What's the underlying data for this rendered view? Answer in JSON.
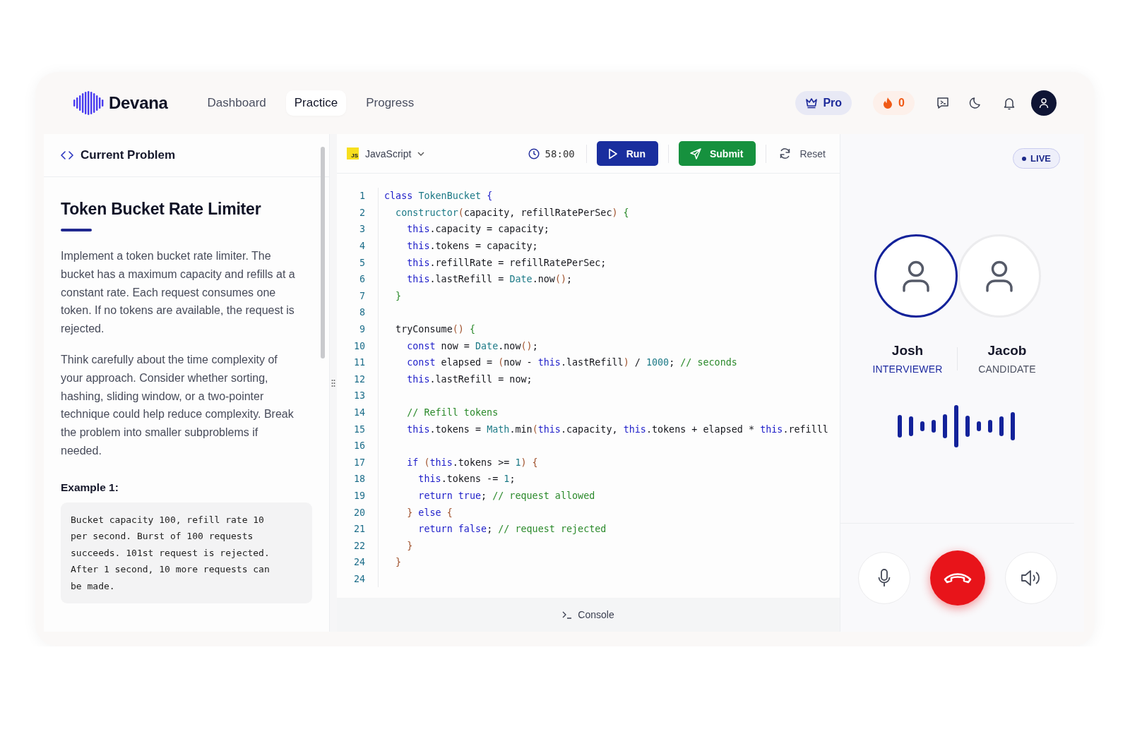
{
  "header": {
    "logo": "Devana",
    "tabs": [
      {
        "label": "Dashboard",
        "selected": false
      },
      {
        "label": "Practice",
        "selected": true
      },
      {
        "label": "Progress",
        "selected": false
      }
    ],
    "plan": "Pro",
    "streak": "0"
  },
  "problem_panel": {
    "heading": "Current Problem",
    "title": "Token Bucket Rate Limiter",
    "paragraphs": [
      "Implement a token bucket rate limiter. The bucket has a maximum capacity and refills at a constant rate. Each request consumes one token. If no tokens are available, the request is rejected.",
      "Think carefully about the time complexity of your approach. Consider whether sorting, hashing, sliding window, or a two-pointer technique could help reduce complexity. Break the problem into smaller subproblems if needed."
    ],
    "example_label": "Example 1:",
    "example_text": "Bucket capacity 100, refill rate 10 per second. Burst of 100 requests succeeds. 101st request is rejected. After 1 second, 10 more requests can be made."
  },
  "editor": {
    "language_badge": "JS",
    "language": "JavaScript",
    "timer": "58:00",
    "run": "Run",
    "submit": "Submit",
    "reset": "Reset",
    "console": "Console",
    "lines": [
      {
        "number": "1",
        "tokens": [
          {
            "kind": "keyword",
            "text": "class "
          },
          {
            "kind": "type",
            "text": "TokenBucket "
          },
          {
            "kind": "bracket1",
            "text": "{"
          }
        ]
      },
      {
        "number": "2",
        "tokens": [
          {
            "kind": "type",
            "text": "  constructor"
          },
          {
            "kind": "bracket3",
            "text": "("
          },
          {
            "kind": "plain",
            "text": "capacity, refillRatePerSec"
          },
          {
            "kind": "bracket3",
            "text": ")"
          },
          {
            "kind": "bracket2",
            "text": " {"
          }
        ]
      },
      {
        "number": "3",
        "tokens": [
          {
            "kind": "keyword",
            "text": "    this"
          },
          {
            "kind": "plain",
            "text": ".capacity = capacity;"
          }
        ]
      },
      {
        "number": "4",
        "tokens": [
          {
            "kind": "keyword",
            "text": "    this"
          },
          {
            "kind": "plain",
            "text": ".tokens = capacity;"
          }
        ]
      },
      {
        "number": "5",
        "tokens": [
          {
            "kind": "keyword",
            "text": "    this"
          },
          {
            "kind": "plain",
            "text": ".refillRate = refillRatePerSec;"
          }
        ]
      },
      {
        "number": "6",
        "tokens": [
          {
            "kind": "keyword",
            "text": "    this"
          },
          {
            "kind": "plain",
            "text": ".lastRefill = "
          },
          {
            "kind": "type",
            "text": "Date"
          },
          {
            "kind": "plain",
            "text": ".now"
          },
          {
            "kind": "bracket3",
            "text": "()"
          },
          {
            "kind": "plain",
            "text": ";"
          }
        ]
      },
      {
        "number": "7",
        "tokens": [
          {
            "kind": "bracket2",
            "text": "  }"
          }
        ]
      },
      {
        "number": "8"
      },
      {
        "number": "9",
        "tokens": [
          {
            "kind": "plain",
            "text": "  tryConsume"
          },
          {
            "kind": "bracket3",
            "text": "()"
          },
          {
            "kind": "bracket2",
            "text": " {"
          }
        ]
      },
      {
        "number": "10",
        "tokens": [
          {
            "kind": "keyword",
            "text": "    const"
          },
          {
            "kind": "plain",
            "text": " now = "
          },
          {
            "kind": "type",
            "text": "Date"
          },
          {
            "kind": "plain",
            "text": ".now"
          },
          {
            "kind": "bracket3",
            "text": "()"
          },
          {
            "kind": "plain",
            "text": ";"
          }
        ]
      },
      {
        "number": "11",
        "tokens": [
          {
            "kind": "keyword",
            "text": "    const"
          },
          {
            "kind": "plain",
            "text": " elapsed = "
          },
          {
            "kind": "bracket3",
            "text": "("
          },
          {
            "kind": "plain",
            "text": "now - "
          },
          {
            "kind": "keyword",
            "text": "this"
          },
          {
            "kind": "plain",
            "text": ".lastRefill"
          },
          {
            "kind": "bracket3",
            "text": ")"
          },
          {
            "kind": "plain",
            "text": " / "
          },
          {
            "kind": "number",
            "text": "1000"
          },
          {
            "kind": "plain",
            "text": "; "
          },
          {
            "kind": "comment",
            "text": "// seconds"
          }
        ]
      },
      {
        "number": "12",
        "tokens": [
          {
            "kind": "keyword",
            "text": "    this"
          },
          {
            "kind": "plain",
            "text": ".lastRefill = now;"
          }
        ]
      },
      {
        "number": "13"
      },
      {
        "number": "14",
        "tokens": [
          {
            "kind": "comment",
            "text": "    // Refill tokens"
          }
        ]
      },
      {
        "number": "15",
        "tokens": [
          {
            "kind": "keyword",
            "text": "    this"
          },
          {
            "kind": "plain",
            "text": ".tokens = "
          },
          {
            "kind": "type",
            "text": "Math"
          },
          {
            "kind": "plain",
            "text": ".min"
          },
          {
            "kind": "bracket3",
            "text": "("
          },
          {
            "kind": "keyword",
            "text": "this"
          },
          {
            "kind": "plain",
            "text": ".capacity, "
          },
          {
            "kind": "keyword",
            "text": "this"
          },
          {
            "kind": "plain",
            "text": ".tokens + elapsed * "
          },
          {
            "kind": "keyword",
            "text": "this"
          },
          {
            "kind": "plain",
            "text": ".refilll"
          }
        ]
      },
      {
        "number": "16"
      },
      {
        "number": "17",
        "tokens": [
          {
            "kind": "keyword",
            "text": "    if "
          },
          {
            "kind": "bracket3",
            "text": "("
          },
          {
            "kind": "keyword",
            "text": "this"
          },
          {
            "kind": "plain",
            "text": ".tokens >= "
          },
          {
            "kind": "number",
            "text": "1"
          },
          {
            "kind": "bracket3",
            "text": ")"
          },
          {
            "kind": "bracket3",
            "text": " {"
          }
        ]
      },
      {
        "number": "18",
        "tokens": [
          {
            "kind": "keyword",
            "text": "      this"
          },
          {
            "kind": "plain",
            "text": ".tokens -= "
          },
          {
            "kind": "number",
            "text": "1"
          },
          {
            "kind": "plain",
            "text": ";"
          }
        ]
      },
      {
        "number": "19",
        "tokens": [
          {
            "kind": "keyword",
            "text": "      return true"
          },
          {
            "kind": "plain",
            "text": "; "
          },
          {
            "kind": "comment",
            "text": "// request allowed"
          }
        ]
      },
      {
        "number": "20",
        "tokens": [
          {
            "kind": "bracket3",
            "text": "    }"
          },
          {
            "kind": "keyword",
            "text": " else "
          },
          {
            "kind": "bracket3",
            "text": "{"
          }
        ]
      },
      {
        "number": "21",
        "tokens": [
          {
            "kind": "keyword",
            "text": "      return false"
          },
          {
            "kind": "plain",
            "text": "; "
          },
          {
            "kind": "comment",
            "text": "// request rejected"
          }
        ]
      },
      {
        "number": "22",
        "tokens": [
          {
            "kind": "bracket3",
            "text": "    }"
          }
        ]
      },
      {
        "number": "24",
        "tokens": [
          {
            "kind": "bracket3",
            "text": "  }"
          }
        ]
      },
      {
        "number": "24"
      }
    ]
  },
  "call_panel": {
    "status": "LIVE",
    "participants": [
      {
        "name": "Josh",
        "role": "INTERVIEWER",
        "active": true
      },
      {
        "name": "Jacob",
        "role": "CANDIDATE",
        "active": false
      }
    ]
  }
}
